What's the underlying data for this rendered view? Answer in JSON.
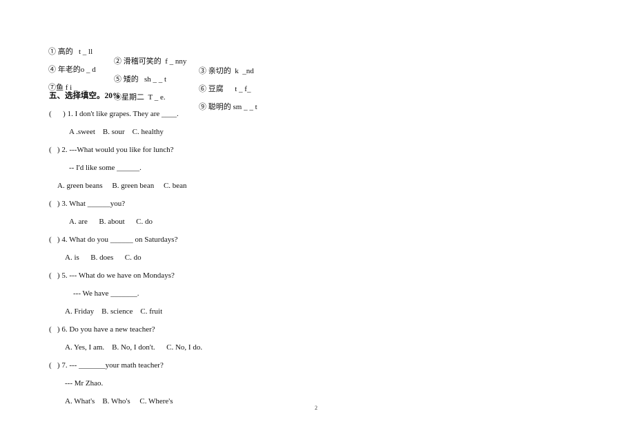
{
  "vocab": {
    "rows": [
      [
        {
          "num": "①",
          "cn": "高的",
          "en": "t _ ll"
        },
        {
          "num": "②",
          "cn": "滑稽可笑的",
          "en": "f _ nny"
        },
        {
          "num": "③",
          "cn": "亲切的",
          "en": "k  _nd"
        }
      ],
      [
        {
          "num": "④",
          "cn": "年老的",
          "en": "o _ d"
        },
        {
          "num": "⑤",
          "cn": "矮的",
          "en": "sh _ _ t"
        },
        {
          "num": "⑥",
          "cn": "豆腐",
          "en": "t _ f_"
        }
      ],
      [
        {
          "num": "⑦",
          "cn": "鱼",
          "en": "f i _   _"
        },
        {
          "num": "⑧",
          "cn": "星期二",
          "en": "T _ e."
        },
        {
          "num": "⑨",
          "cn": "聪明的",
          "en": "sm _ _ t"
        }
      ]
    ]
  },
  "section": {
    "title": "五、选择填空。20%"
  },
  "questions": [
    {
      "stem": "(      ) 1. I don't like grapes. They are ____.",
      "options": "A .sweet    B. sour    C. healthy"
    },
    {
      "stem": "(   ) 2. ---What would you like for lunch?",
      "sub": "-- I'd like some ______.",
      "options": "A. green beans     B. green bean     C. bean"
    },
    {
      "stem": "(   ) 3. What ______you?",
      "options": "A. are      B. about      C. do"
    },
    {
      "stem": "(   ) 4. What do you ______ on Saturdays?",
      "options": "A. is      B. does      C. do"
    },
    {
      "stem": "(   ) 5. --- What do we have on Mondays?",
      "sub": "--- We have _______.",
      "options": "A. Friday    B. science    C. fruit"
    },
    {
      "stem": "(   ) 6. Do you have a new teacher?",
      "options": "A. Yes, I am.    B. No, I don't.      C. No, I do."
    },
    {
      "stem": "(   ) 7. --- _______your math teacher?",
      "sub": "--- Mr Zhao.",
      "options": "A. What's    B. Who's     C. Where's"
    }
  ],
  "page_number": "2"
}
